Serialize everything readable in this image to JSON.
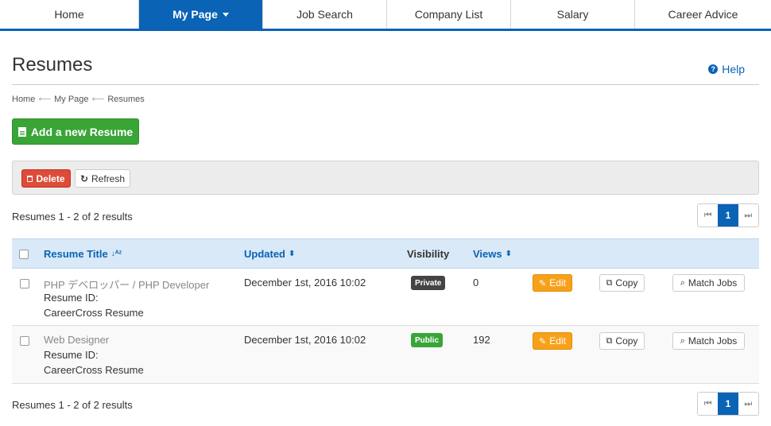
{
  "nav": {
    "items": [
      {
        "label": "Home"
      },
      {
        "label": "My Page"
      },
      {
        "label": "Job Search"
      },
      {
        "label": "Company List"
      },
      {
        "label": "Salary"
      },
      {
        "label": "Career Advice"
      }
    ]
  },
  "header": {
    "title": "Resumes",
    "help_label": "Help"
  },
  "breadcrumb": [
    "Home",
    "My Page",
    "Resumes"
  ],
  "actions": {
    "add_label": "Add a new Resume",
    "delete_label": "Delete",
    "refresh_label": "Refresh"
  },
  "summary": {
    "top": "Resumes 1 - 2 of 2 results",
    "bottom": "Resumes 1 - 2 of 2 results"
  },
  "pagination": {
    "current": "1"
  },
  "table": {
    "headers": {
      "title": "Resume Title",
      "updated": "Updated",
      "visibility": "Visibility",
      "views": "Views"
    },
    "rows": [
      {
        "title": "PHP デベロッパー / PHP Developer",
        "resume_id": "Resume ID:",
        "type": "CareerCross Resume",
        "updated": "December 1st, 2016 10:02",
        "visibility": "Private",
        "views": "0",
        "edit": "Edit",
        "copy": "Copy",
        "match": "Match Jobs"
      },
      {
        "title": "Web Designer",
        "resume_id": "Resume ID:",
        "type": "CareerCross Resume",
        "updated": "December 1st, 2016 10:02",
        "visibility": "Public",
        "views": "192",
        "edit": "Edit",
        "copy": "Copy",
        "match": "Match Jobs"
      }
    ]
  },
  "colors": {
    "primary": "#0a63b5",
    "success": "#3aa537",
    "danger": "#dd4b39",
    "warning": "#f7a11a"
  }
}
